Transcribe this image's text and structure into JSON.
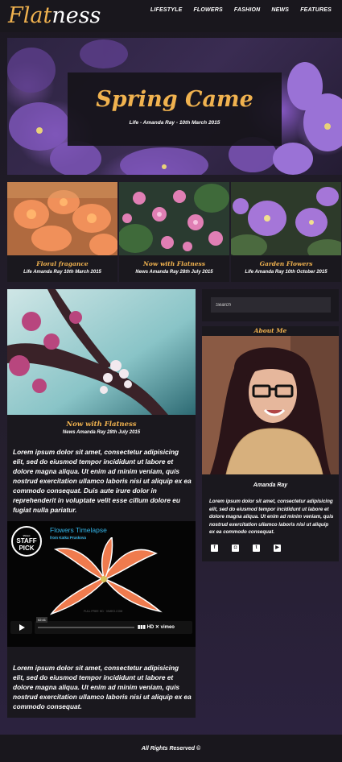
{
  "header": {
    "logo_accent": "Flat",
    "logo_rest": "ness",
    "nav": [
      "LIFESTYLE",
      "FLOWERS",
      "FASHION",
      "NEWS",
      "FEATURES"
    ]
  },
  "hero": {
    "title": "Spring Came",
    "meta": "Life - Amanda Ray - 10th March 2015"
  },
  "cards": [
    {
      "title": "Floral fragance",
      "meta": "Life Amanda Ray 10th March 2015"
    },
    {
      "title": "Now with Flatness",
      "meta": "News Amanda Ray 28th July 2015"
    },
    {
      "title": "Garden Flowers",
      "meta": "Life Amanda Ray 10th October 2015"
    }
  ],
  "post": {
    "title": "Now with Flatness",
    "meta": "News Amanda Ray 28th July 2015",
    "body1": "Lorem ipsum dolor sit amet, consectetur adipisicing elit, sed do eiusmod tempor incididunt ut labore et dolore magna aliqua. Ut enim ad minim veniam, quis nostrud exercitation ullamco laboris nisi ut aliquip ex ea commodo consequat. Duis aute irure dolor in reprehenderit in voluptate velit esse cillum dolore eu fugiat nulla pariatur.",
    "body2": "Lorem ipsum dolor sit amet, consectetur adipisicing elit, sed do eiusmod tempor incididunt ut labore et dolore magna aliqua. Ut enim ad minim veniam, quis nostrud exercitation ullamco laboris nisi ut aliquip ex ea commodo consequat."
  },
  "video": {
    "badge_top": "Vimeo",
    "badge_main": "STAFF PICK",
    "title": "Flowers Timelapse",
    "by_label": "from",
    "by_name": "Katka Pruskova",
    "time": "02:41",
    "hd": "HD",
    "brand": "vimeo"
  },
  "sidebar": {
    "search_placeholder": "Search",
    "about_title": "About Me",
    "name": "Amanda Ray",
    "bio": "Lorem ipsum dolor sit amet, consectetur adipisicing elit, sed do eiusmod tempor incididunt ut labore et dolore magna aliqua. Ut enim ad minim veniam, quis nostrud exercitation ullamco laboris nisi ut aliquip ex ea commodo consequat.",
    "socials": [
      "facebook-icon",
      "instagram-icon",
      "twitter-icon",
      "youtube-icon"
    ]
  },
  "footer": {
    "text": "All Rights Reserved ©"
  },
  "colors": {
    "accent": "#f0b24f",
    "panel": "#1a181e",
    "link": "#34b5e8"
  }
}
